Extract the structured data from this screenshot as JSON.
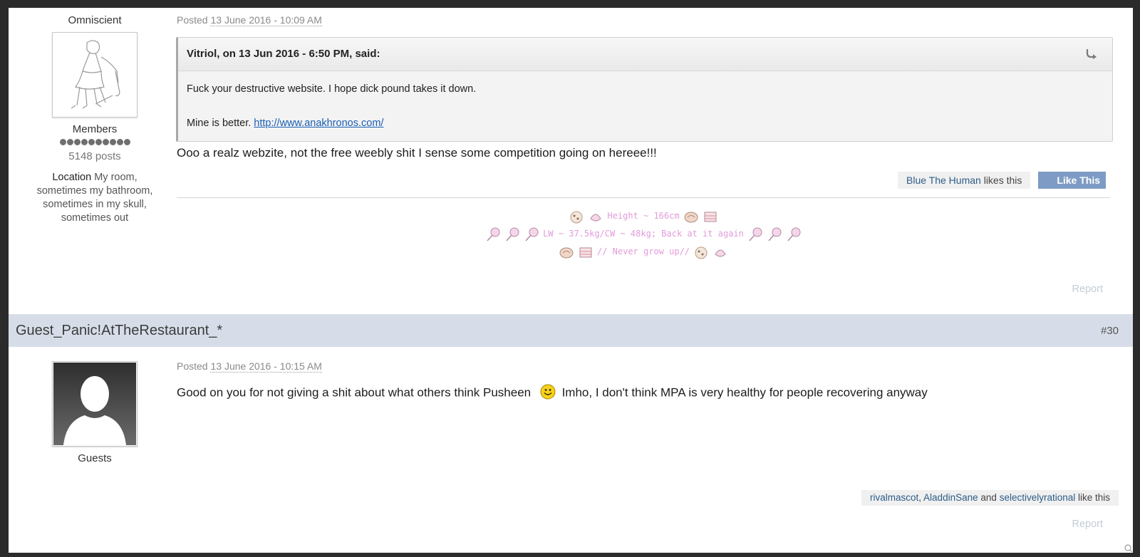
{
  "post1": {
    "author": {
      "rank_title": "Omniscient",
      "group": "Members",
      "pips": 10,
      "posts": "5148 posts",
      "location_label": "Location",
      "location_value": "My room, sometimes my bathroom, sometimes in my skull, sometimes out"
    },
    "posted_label": "Posted",
    "date": "13 June 2016 - 10:09 AM",
    "quote": {
      "header": "Vitriol, on 13 Jun 2016 - 6:50 PM, said:",
      "line1": "Fuck your destructive website. I hope dick pound takes it down.",
      "line2_prefix": "Mine is better.",
      "link": "http://www.anakhronos.com/"
    },
    "text": "Ooo a realz webzite, not the free weebly shit I sense some competition going on hereee!!!",
    "likes": {
      "user": "Blue The Human",
      "suffix": "likes this"
    },
    "like_button": "Like This",
    "signature": {
      "line1": "Height ~ 166cm",
      "line2": "LW ~ 37.5kg/CW ~ 48kg; Back at it again",
      "line3": "// Never grow up//"
    },
    "report": "Report"
  },
  "post2": {
    "header_name": "Guest_Panic!AtTheRestaurant_*",
    "post_number": "#30",
    "author": {
      "group": "Guests"
    },
    "posted_label": "Posted",
    "date": "13 June 2016 - 10:15 AM",
    "text_before": "Good on you for not giving a shit about what others think Pusheen",
    "text_after": "Imho, I don't think MPA is very healthy for people recovering anyway",
    "likes": {
      "user1": "rivalmascot",
      "sep": ",",
      "user2": "AladdinSane",
      "and": "and",
      "user3": "selectivelyrational",
      "suffix": "like this"
    },
    "report": "Report"
  },
  "icons": [
    "sketch-avatar-icon",
    "reply-arrow-icon",
    "lollipop-icon",
    "pastry-icon",
    "cookie-icon",
    "strawberry-cake-icon",
    "smiley-icon",
    "guest-avatar-icon"
  ],
  "colors": {
    "header_bg": "#d7dde8",
    "like_button": "#7d9bc5",
    "link": "#2c5d88",
    "signature": "#e29bd9"
  }
}
